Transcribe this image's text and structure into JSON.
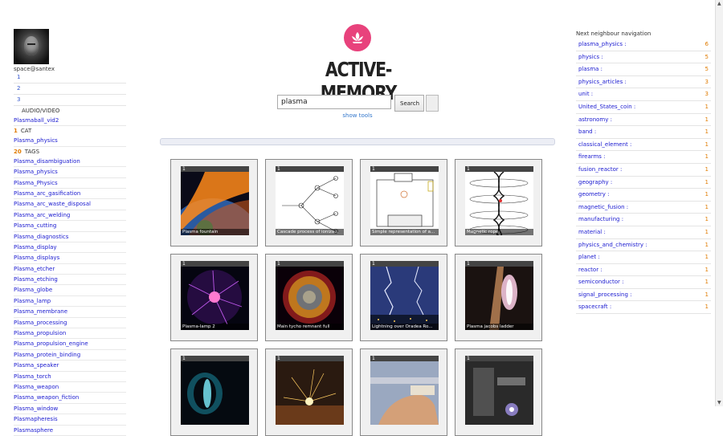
{
  "user": {
    "name": "space@santex"
  },
  "pages": [
    "1",
    "2",
    "3"
  ],
  "audio_video": {
    "label": "AUDIO/VIDEO",
    "items": [
      "Plasmaball_vid2"
    ]
  },
  "cat": {
    "count": "1",
    "label": "CAT",
    "items": [
      "Plasma_physics"
    ]
  },
  "tags": {
    "count": "20",
    "label": "TAGS",
    "items": [
      "Plasma_disambiguation",
      "Plasma_physics",
      "Plasma_Physics",
      "Plasma_arc_gasification",
      "Plasma_arc_waste_disposal",
      "Plasma_arc_welding",
      "Plasma_cutting",
      "Plasma_diagnostics",
      "Plasma_display",
      "Plasma_displays",
      "Plasma_etcher",
      "Plasma_etching",
      "Plasma_globe",
      "Plasma_lamp",
      "Plasma_membrane",
      "Plasma_processing",
      "Plasma_propulsion",
      "Plasma_propulsion_engine",
      "Plasma_protein_binding",
      "Plasma_speaker",
      "Plasma_torch",
      "Plasma_weapon",
      "Plasma_weapon_fiction",
      "Plasma_window",
      "Plasmapheresis",
      "Plasmasphere"
    ]
  },
  "brand": {
    "title": "ACTIVE-MEMORY",
    "accent": "#e8427c"
  },
  "search": {
    "value": "plasma",
    "button": "Search",
    "show_tools": "show tools"
  },
  "tiles": [
    {
      "num": "1",
      "caption": "Plasma fountain",
      "scene": "earth"
    },
    {
      "num": "1",
      "caption": "Cascade process of ioniza...",
      "scene": "cascade"
    },
    {
      "num": "1",
      "caption": "Simple representation of a...",
      "scene": "circuit"
    },
    {
      "num": "1",
      "caption": "Magnetic rope",
      "scene": "rope"
    },
    {
      "num": "1",
      "caption": "Plasma-lamp 2",
      "scene": "lamp"
    },
    {
      "num": "1",
      "caption": "Main tycho remnant full",
      "scene": "tycho"
    },
    {
      "num": "1",
      "caption": "Lightning over Oradea Ro...",
      "scene": "lightning"
    },
    {
      "num": "1",
      "caption": "Plasma jacobs ladder",
      "scene": "jacobs"
    },
    {
      "num": "1",
      "caption": "",
      "scene": "thruster"
    },
    {
      "num": "1",
      "caption": "",
      "scene": "sparks"
    },
    {
      "num": "1",
      "caption": "",
      "scene": "hand"
    },
    {
      "num": "1",
      "caption": "",
      "scene": "machine"
    }
  ],
  "nav": {
    "title": "Next neighbour navigation",
    "items": [
      {
        "label": "plasma_physics :",
        "count": "6"
      },
      {
        "label": "physics :",
        "count": "5"
      },
      {
        "label": "plasma :",
        "count": "5"
      },
      {
        "label": "physics_articles :",
        "count": "3"
      },
      {
        "label": "unit :",
        "count": "3"
      },
      {
        "label": "United_States_coin :",
        "count": "1"
      },
      {
        "label": "astronomy :",
        "count": "1"
      },
      {
        "label": "band :",
        "count": "1"
      },
      {
        "label": "classical_element :",
        "count": "1"
      },
      {
        "label": "firearms :",
        "count": "1"
      },
      {
        "label": "fusion_reactor :",
        "count": "1"
      },
      {
        "label": "geography :",
        "count": "1"
      },
      {
        "label": "geometry :",
        "count": "1"
      },
      {
        "label": "magnetic_fusion :",
        "count": "1"
      },
      {
        "label": "manufacturing :",
        "count": "1"
      },
      {
        "label": "material :",
        "count": "1"
      },
      {
        "label": "physics_and_chemistry :",
        "count": "1"
      },
      {
        "label": "planet :",
        "count": "1"
      },
      {
        "label": "reactor :",
        "count": "1"
      },
      {
        "label": "semiconductor :",
        "count": "1"
      },
      {
        "label": "signal_processing :",
        "count": "1"
      },
      {
        "label": "spacecraft :",
        "count": "1"
      }
    ]
  }
}
